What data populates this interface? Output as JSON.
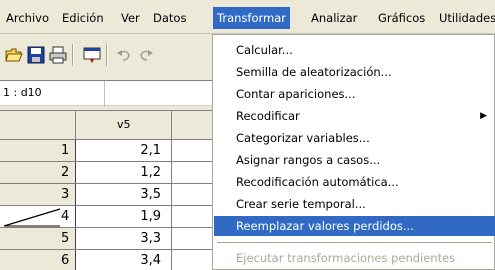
{
  "menubar": {
    "items": [
      "Archivo",
      "Edición",
      "Ver",
      "Datos",
      "Transformar",
      "Analizar",
      "Gráficos",
      "Utilidades"
    ],
    "active": "Transformar"
  },
  "toolbar": {
    "icons": [
      "open-icon",
      "save-icon",
      "print-icon",
      "dialog-recall-icon",
      "undo-icon",
      "redo-icon"
    ]
  },
  "cell_editor": {
    "reference": "1 : d10"
  },
  "grid": {
    "columns": [
      "v5"
    ],
    "rows": [
      {
        "num": "1",
        "v5": "2,1"
      },
      {
        "num": "2",
        "v5": "1,2"
      },
      {
        "num": "3",
        "v5": "3,5"
      },
      {
        "num": "4",
        "v5": "1,9"
      },
      {
        "num": "5",
        "v5": "3,3"
      },
      {
        "num": "6",
        "v5": "3,4"
      }
    ]
  },
  "dropdown": {
    "items": [
      {
        "label": "Calcular...",
        "submenu": false
      },
      {
        "label": "Semilla de aleatorización...",
        "submenu": false
      },
      {
        "label": "Contar apariciones...",
        "submenu": false
      },
      {
        "label": "Recodificar",
        "submenu": true
      },
      {
        "label": "Categorizar variables...",
        "submenu": false
      },
      {
        "label": "Asignar rangos a casos...",
        "submenu": false
      },
      {
        "label": "Recodificación automática...",
        "submenu": false
      },
      {
        "label": "Crear serie temporal...",
        "submenu": false
      },
      {
        "label": "Reemplazar valores perdidos...",
        "submenu": false,
        "highlighted": true
      }
    ],
    "disabled_items": [
      {
        "label": "Ejecutar transformaciones pendientes"
      }
    ]
  },
  "colors": {
    "highlight": "#316ac5",
    "chrome": "#ece9d8",
    "disabled_text": "#aca899"
  }
}
